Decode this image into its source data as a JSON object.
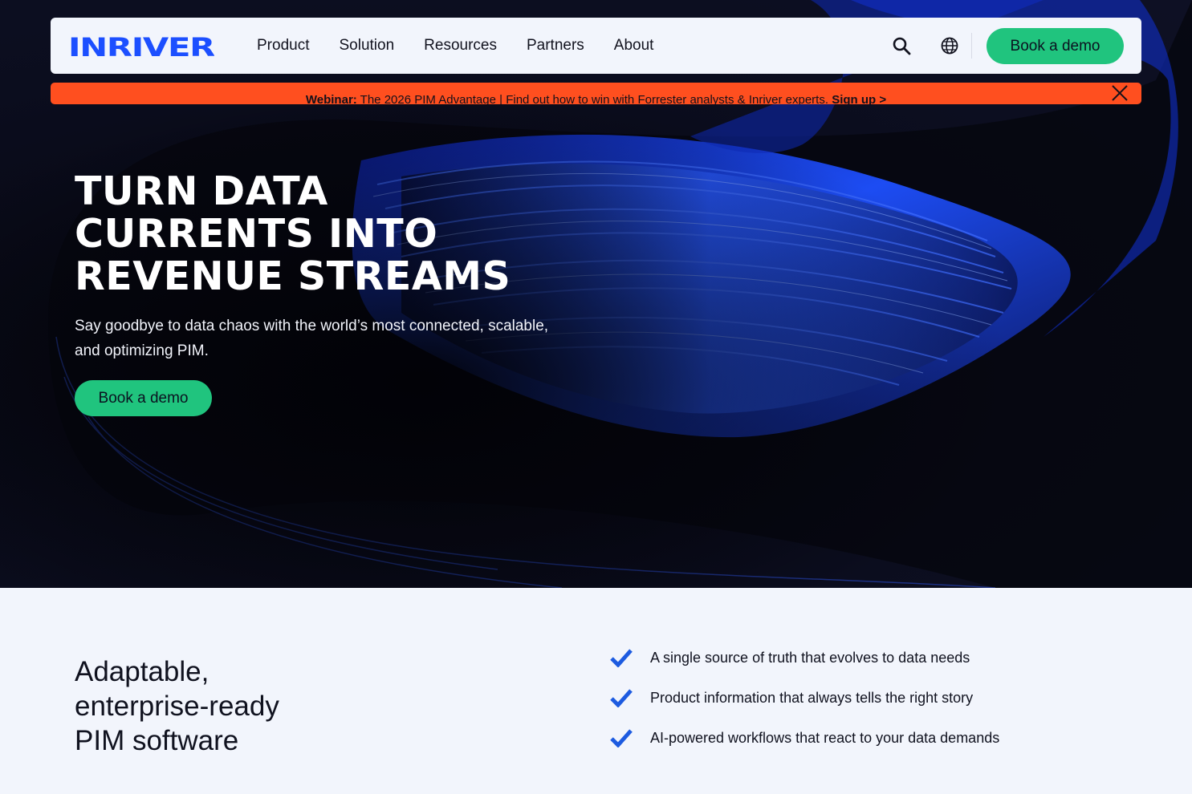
{
  "brand": {
    "logo_text": "INRIVER",
    "logo_color": "#1c4fff"
  },
  "nav": {
    "items": [
      {
        "label": "Product"
      },
      {
        "label": "Solution"
      },
      {
        "label": "Resources"
      },
      {
        "label": "Partners"
      },
      {
        "label": "About"
      }
    ],
    "search_icon": "search-icon",
    "globe_icon": "globe-icon",
    "cta_label": "Book a demo"
  },
  "banner": {
    "lead": "Webinar:",
    "message": " The 2026 PIM Advantage | Find out how to win with Forrester analysts & Inriver experts. ",
    "link_label": "Sign up >",
    "close_icon": "close-icon",
    "color": "#ff4f1f"
  },
  "hero": {
    "title_lines": [
      "TURN DATA",
      "CURRENTS INTO",
      "REVENUE STREAMS"
    ],
    "subtitle": "Say goodbye to data chaos with the world’s most connected, scalable, and optimizing PIM.",
    "cta_label": "Book a demo",
    "accent_color": "#20c47e"
  },
  "features": {
    "title_lines": [
      "Adaptable,",
      "enterprise-ready",
      "PIM software"
    ],
    "items": [
      {
        "icon": "check-icon",
        "text": "A single source of truth that evolves to data needs"
      },
      {
        "icon": "check-icon",
        "text": "Product information that always tells the right story"
      },
      {
        "icon": "check-icon",
        "text": "AI-powered workflows that react to your data demands"
      }
    ],
    "check_color": "#1d5be0"
  }
}
